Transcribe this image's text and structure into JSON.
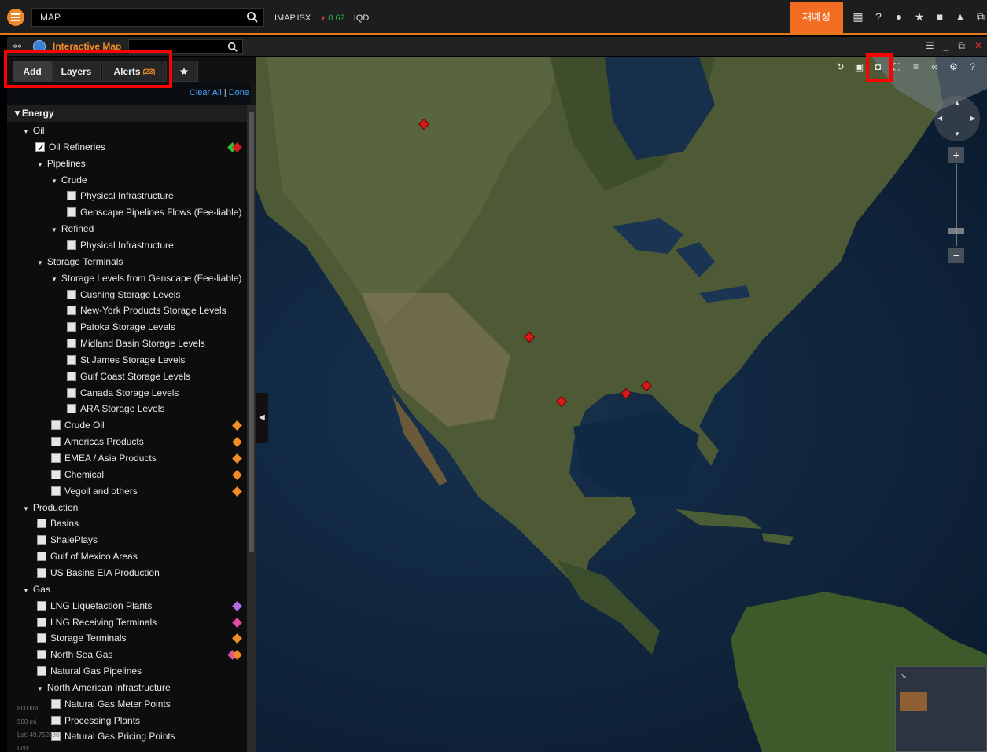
{
  "topbar": {
    "search_value": "MAP",
    "ticker_symbol": "IMAP.ISX",
    "ticker_change": "0.62",
    "ticker_currency": "IQD",
    "user_label": "채예정",
    "icons": [
      "layout-icon",
      "help-icon",
      "chat-icon",
      "star-icon",
      "briefcase-icon",
      "bell-icon",
      "window-icon"
    ]
  },
  "app": {
    "title": "Interactive Map"
  },
  "tabs": {
    "add": "Add",
    "layers": "Layers",
    "alerts": "Alerts",
    "alerts_count": "(23)"
  },
  "actions": {
    "clear_all": "Clear All",
    "separator": "|",
    "done": "Done"
  },
  "tree": {
    "root": "Energy",
    "items": [
      {
        "label": "Oil",
        "type": "group"
      },
      {
        "label": "Oil Refineries",
        "type": "check",
        "checked": true,
        "legend": [
          "#2ec02e",
          "#d31d1d"
        ]
      },
      {
        "label": "Pipelines",
        "type": "group"
      },
      {
        "label": "Crude",
        "type": "group"
      },
      {
        "label": "Physical Infrastructure",
        "type": "check"
      },
      {
        "label": "Genscape Pipelines Flows (Fee-liable)",
        "type": "check"
      },
      {
        "label": "Refined",
        "type": "group"
      },
      {
        "label": "Physical Infrastructure",
        "type": "check"
      },
      {
        "label": "Storage Terminals",
        "type": "group"
      },
      {
        "label": "Storage Levels from Genscape (Fee-liable)",
        "type": "group"
      },
      {
        "label": "Cushing Storage Levels",
        "type": "check"
      },
      {
        "label": "New-York Products Storage Levels",
        "type": "check"
      },
      {
        "label": "Patoka Storage Levels",
        "type": "check"
      },
      {
        "label": "Midland Basin Storage Levels",
        "type": "check"
      },
      {
        "label": "St James Storage Levels",
        "type": "check"
      },
      {
        "label": "Gulf Coast Storage Levels",
        "type": "check"
      },
      {
        "label": "Canada Storage Levels",
        "type": "check"
      },
      {
        "label": "ARA Storage Levels",
        "type": "check"
      },
      {
        "label": "Crude Oil",
        "type": "check",
        "legend": [
          "#f28c28"
        ]
      },
      {
        "label": "Americas Products",
        "type": "check",
        "legend": [
          "#f28c28"
        ]
      },
      {
        "label": "EMEA / Asia Products",
        "type": "check",
        "legend": [
          "#f28c28"
        ]
      },
      {
        "label": "Chemical",
        "type": "check",
        "legend": [
          "#f28c28"
        ]
      },
      {
        "label": "Vegoil and others",
        "type": "check",
        "legend": [
          "#f28c28"
        ]
      },
      {
        "label": "Production",
        "type": "group"
      },
      {
        "label": "Basins",
        "type": "check"
      },
      {
        "label": "ShalePlays",
        "type": "check"
      },
      {
        "label": "Gulf of Mexico Areas",
        "type": "check"
      },
      {
        "label": "US Basins EIA Production",
        "type": "check"
      },
      {
        "label": "Gas",
        "type": "group"
      },
      {
        "label": "LNG Liquefaction Plants",
        "type": "check",
        "legend": [
          "#b26de0"
        ]
      },
      {
        "label": "LNG Receiving Terminals",
        "type": "check",
        "legend": [
          "#e04fa0"
        ]
      },
      {
        "label": "Storage Terminals",
        "type": "check",
        "legend": [
          "#f28c28"
        ]
      },
      {
        "label": "North Sea Gas",
        "type": "check",
        "legend": [
          "#e04fa0",
          "#f28c28"
        ]
      },
      {
        "label": "Natural Gas Pipelines",
        "type": "check"
      },
      {
        "label": "North American Infrastructure",
        "type": "group"
      },
      {
        "label": "Natural Gas Meter Points",
        "type": "check"
      },
      {
        "label": "Processing Plants",
        "type": "check"
      },
      {
        "label": "Natural Gas Pricing Points",
        "type": "check"
      }
    ]
  },
  "scale": {
    "km": "800 km",
    "mi": "500 mi",
    "lat_label": "Lat:",
    "lat_value": "49.752880",
    "lon_label": "Lon:"
  },
  "map_tools": [
    "refresh-icon",
    "bookmark-icon",
    "snapshot-icon",
    "fullscreen-icon",
    "list-icon",
    "link-icon",
    "settings-icon",
    "help-icon"
  ],
  "colors": {
    "accent": "#f28c28",
    "highlight": "#ff0000",
    "marker": "#d31d1d"
  }
}
